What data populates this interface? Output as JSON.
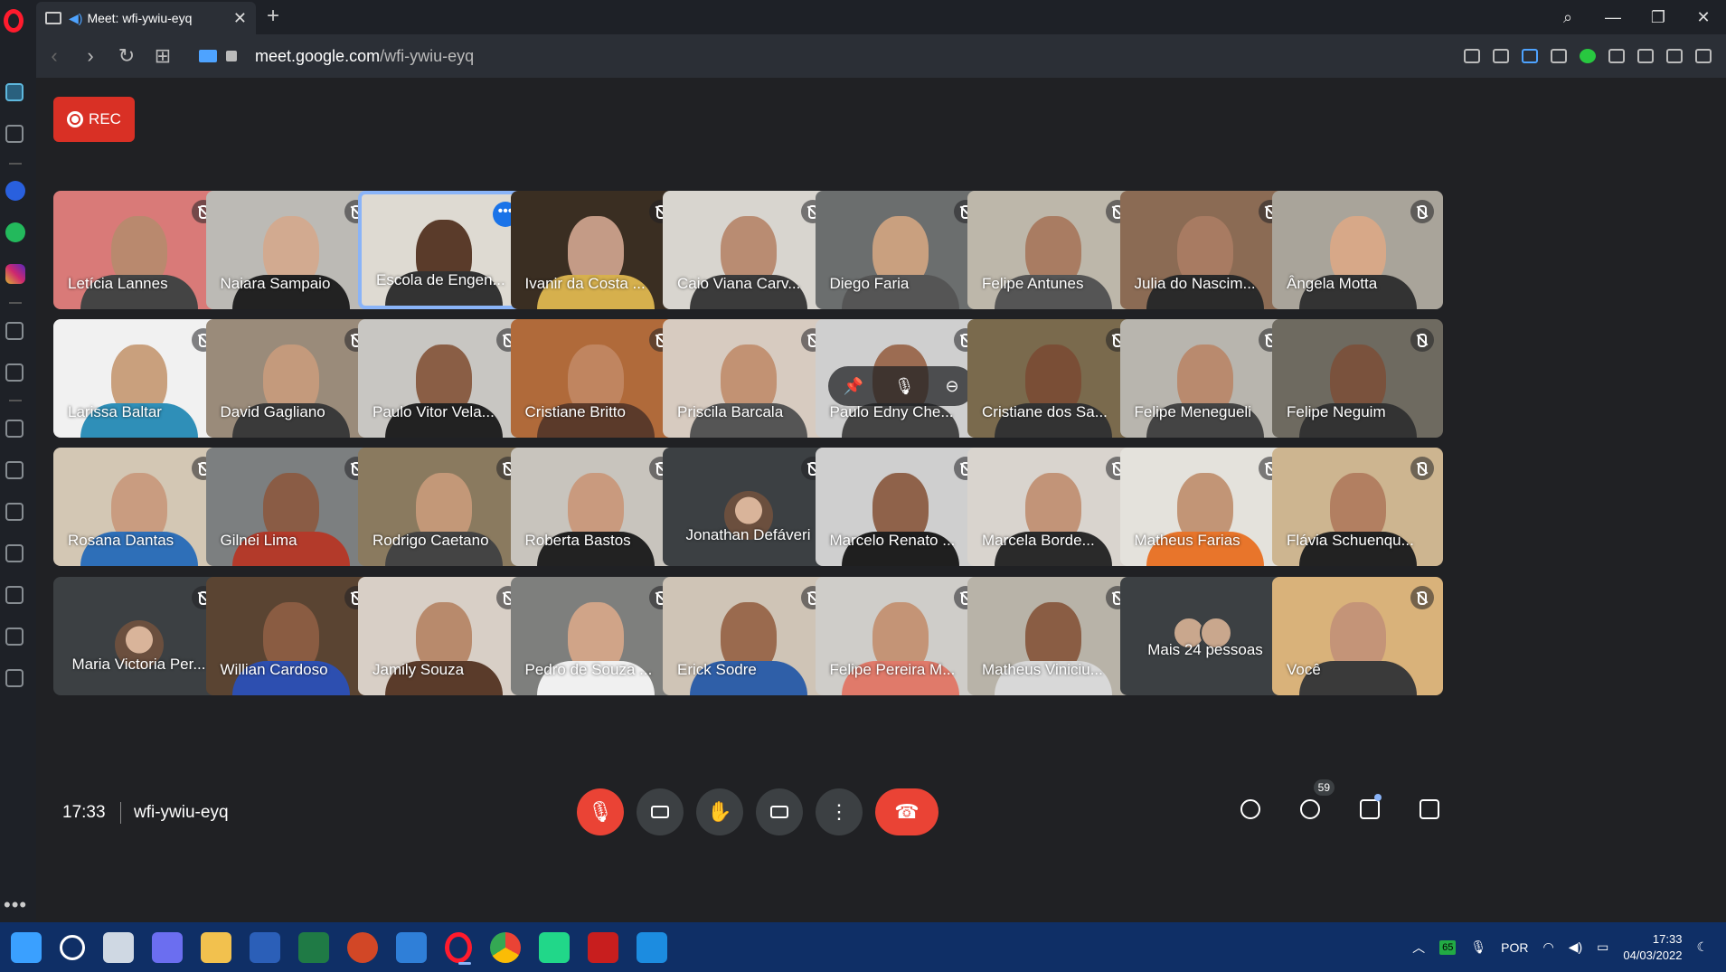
{
  "browser": {
    "tab_title": "Meet: wfi-ywiu-eyq",
    "url_host": "meet.google.com",
    "url_path": "/wfi-ywiu-eyq"
  },
  "meet": {
    "rec_label": "REC",
    "clock": "17:33",
    "meeting_code": "wfi-ywiu-eyq",
    "people_count": "59",
    "more_people": "Mais 24 pessoas",
    "participants": [
      {
        "name": "Letícia Lannes",
        "bg": "#d97a78",
        "skin": "#b9896e",
        "shirt": "#444"
      },
      {
        "name": "Naiara Sampaio",
        "bg": "#bcbab5",
        "skin": "#d2aa90",
        "shirt": "#222"
      },
      {
        "name": "Escola de Engen...",
        "bg": "#dedad2",
        "skin": "#5a3b2a",
        "shirt": "#333",
        "active": true
      },
      {
        "name": "Ivanir da Costa ...",
        "bg": "#3a2e22",
        "skin": "#c49b86",
        "shirt": "#d6b04d"
      },
      {
        "name": "Caio Viana Carv...",
        "bg": "#d8d5cf",
        "skin": "#b98c72",
        "shirt": "#3b3b3b"
      },
      {
        "name": "Diego Faria",
        "bg": "#6b6e6e",
        "skin": "#c9a07f",
        "shirt": "#555"
      },
      {
        "name": "Felipe Antunes",
        "bg": "#bdb7aa",
        "skin": "#a97c62",
        "shirt": "#555"
      },
      {
        "name": "Julia do Nascim...",
        "bg": "#8b6b54",
        "skin": "#a87b62",
        "shirt": "#2a2a2a"
      },
      {
        "name": "Ângela Motta",
        "bg": "#a9a49a",
        "skin": "#d7a888",
        "shirt": "#333"
      },
      {
        "name": "Larissa Baltar",
        "bg": "#f1f1f1",
        "skin": "#c9a07d",
        "shirt": "#2f8fb8"
      },
      {
        "name": "David Gagliano",
        "bg": "#9a8b7a",
        "skin": "#c49a7c",
        "shirt": "#3a3a3a"
      },
      {
        "name": "Paulo Vitor Vela...",
        "bg": "#c8c6c2",
        "skin": "#8a5e45",
        "shirt": "#222"
      },
      {
        "name": "Cristiane Britto",
        "bg": "#b06a3a",
        "skin": "#c08560",
        "shirt": "#5b3a2a"
      },
      {
        "name": "Priscila Barcala",
        "bg": "#d7cbc0",
        "skin": "#c29273",
        "shirt": "#555"
      },
      {
        "name": "Paulo Edny Che...",
        "bg": "#cfcfcf",
        "skin": "#9c6c52",
        "shirt": "#444",
        "hover": true
      },
      {
        "name": "Cristiane dos Sa...",
        "bg": "#7a6a4d",
        "skin": "#7a4e36",
        "shirt": "#333"
      },
      {
        "name": "Felipe Menegueli",
        "bg": "#b8b5ae",
        "skin": "#b98a6e",
        "shirt": "#444"
      },
      {
        "name": "Felipe Neguim",
        "bg": "#6e6a60",
        "skin": "#7a523d",
        "shirt": "#333"
      },
      {
        "name": "Rosana Dantas",
        "bg": "#d3c7b4",
        "skin": "#c99c80",
        "shirt": "#2e6fb8"
      },
      {
        "name": "Gilnei Lima",
        "bg": "#7c7f80",
        "skin": "#8a5c45",
        "shirt": "#b33a2a"
      },
      {
        "name": "Rodrigo Caetano",
        "bg": "#8a7a5f",
        "skin": "#c39878",
        "shirt": "#444"
      },
      {
        "name": "Roberta Bastos",
        "bg": "#c8c4bd",
        "skin": "#c99a7e",
        "shirt": "#222"
      },
      {
        "name": "Jonathan Defáveri",
        "noface": true
      },
      {
        "name": "Marcelo Renato ...",
        "bg": "#cfcfcf",
        "skin": "#8f624a",
        "shirt": "#1f1f1f"
      },
      {
        "name": "Marcela Borde...",
        "bg": "#d9d4ce",
        "skin": "#c29478",
        "shirt": "#2a2a2a"
      },
      {
        "name": "Matheus Farias",
        "bg": "#e4e2dc",
        "skin": "#c29576",
        "shirt": "#e8752b"
      },
      {
        "name": "Flávia Schuenqu...",
        "bg": "#cdb590",
        "skin": "#b27f61",
        "shirt": "#222"
      },
      {
        "name": "Maria Victoria Per...",
        "noface": true
      },
      {
        "name": "Willian Cardoso",
        "bg": "#5a4432",
        "skin": "#8a5c42",
        "shirt": "#2d4fb0"
      },
      {
        "name": "Jamily Souza",
        "bg": "#d8cfc6",
        "skin": "#b88a6c",
        "shirt": "#5a3b2a"
      },
      {
        "name": "Pedro de Souza ...",
        "bg": "#7e7f7d",
        "skin": "#d0a488",
        "shirt": "#f0f0f0"
      },
      {
        "name": "Erick Sodre",
        "bg": "#cfc4b6",
        "skin": "#9a6a4e",
        "shirt": "#2f5fa8"
      },
      {
        "name": "Felipe Pereira M...",
        "bg": "#cfcdc9",
        "skin": "#c49476",
        "shirt": "#e07a6a"
      },
      {
        "name": "Matheus Viniciu...",
        "bg": "#b8b3a8",
        "skin": "#8a5d44",
        "shirt": "#d8d8d8"
      },
      {
        "more": true
      },
      {
        "name": "Você",
        "bg": "#d9b27a",
        "skin": "#c49478",
        "shirt": "#3a3a3a",
        "self": true
      }
    ]
  },
  "taskbar": {
    "lang": "POR",
    "time": "17:33",
    "date": "04/03/2022",
    "battery_badge": "65"
  }
}
